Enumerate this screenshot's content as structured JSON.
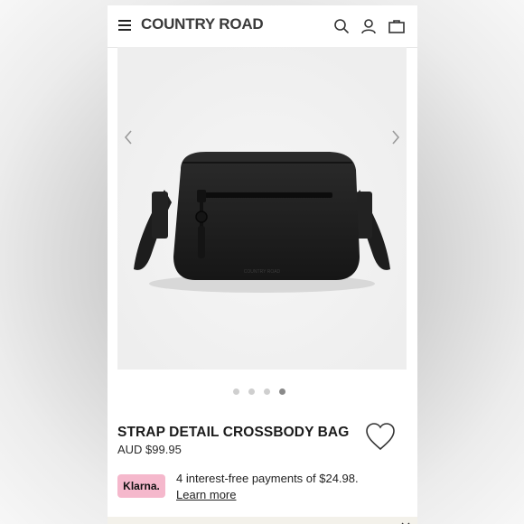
{
  "header": {
    "brand": "COUNTRY ROAD",
    "icons": [
      "menu-icon",
      "search-icon",
      "account-icon",
      "bag-icon"
    ]
  },
  "gallery": {
    "image_alt": "Black crossbody bag with zip front pocket",
    "embossed_logo": "COUNTRY ROAD",
    "slide_count": 4,
    "active_slide": 4
  },
  "product": {
    "title": "STRAP DETAIL CROSSBODY BAG",
    "price": "AUD $99.95"
  },
  "klarna": {
    "badge": "Klarna.",
    "message": "4 interest-free payments of $24.98.",
    "link": "Learn more",
    "badge_color": "#f5b8cc"
  }
}
